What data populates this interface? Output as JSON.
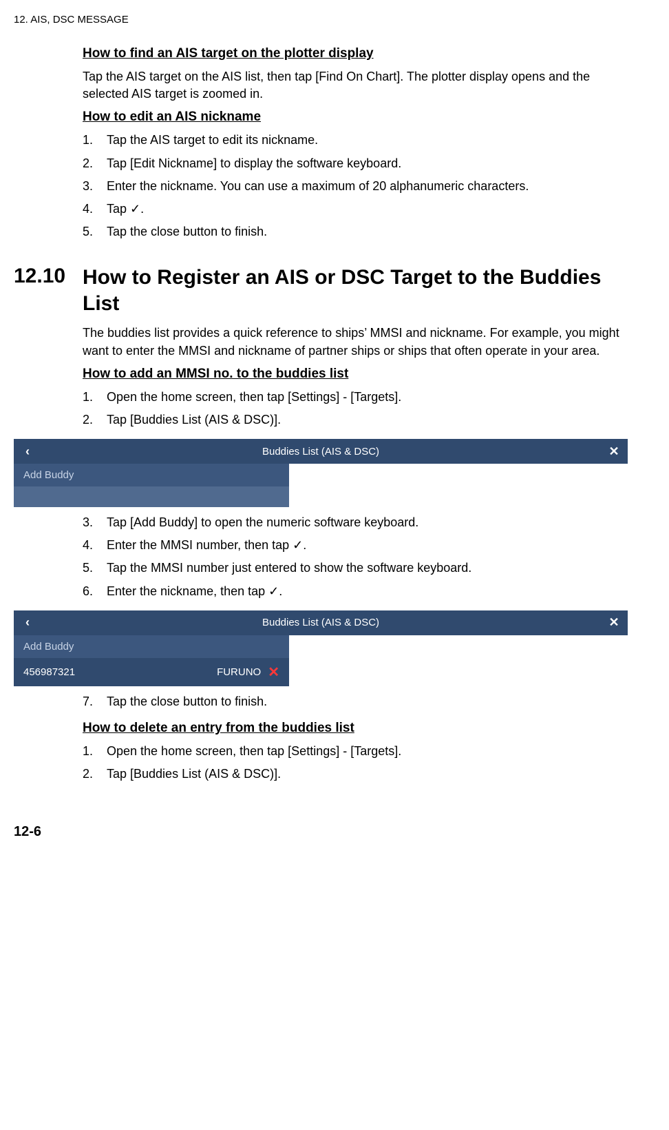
{
  "header": {
    "chapter": "12.  AIS, DSC MESSAGE"
  },
  "s1": {
    "h1": "How to find an AIS target on the plotter display",
    "p1": "Tap the AIS target on the AIS list, then tap [Find On Chart]. The plotter display opens and the selected AIS target is zoomed in.",
    "h2": "How to edit an AIS nickname",
    "items": [
      "Tap the AIS target to edit its nickname.",
      "Tap [Edit Nickname] to display the software keyboard.",
      "Enter the nickname. You can use a maximum of 20 alphanumeric characters.",
      "Tap ✓.",
      "Tap the close button to finish."
    ]
  },
  "s2": {
    "num": "12.10",
    "title": "How to Register an AIS or DSC Target to the Buddies List",
    "p1": "The buddies list provides a quick reference to ships’ MMSI and nickname. For example, you might want to enter the MMSI and nickname of partner ships or ships that often operate in your area.",
    "h1": "How to add an MMSI no. to the buddies list",
    "itemsA": [
      "Open the home screen, then tap [Settings] - [Targets].",
      "Tap [Buddies List (AIS & DSC)]."
    ],
    "itemsB": [
      "Tap [Add Buddy] to open the numeric software keyboard.",
      "Enter the MMSI number, then tap ✓.",
      "Tap the MMSI number just entered to show the software keyboard.",
      "Enter the nickname, then tap ✓."
    ],
    "itemsC": [
      "Tap the close button to finish."
    ],
    "h2": "How to delete an entry from the buddies list",
    "itemsD": [
      "Open the home screen, then tap [Settings] - [Targets].",
      "Tap [Buddies List (AIS & DSC)]."
    ]
  },
  "ui1": {
    "back": "‹",
    "title": "Buddies List (AIS & DSC)",
    "close": "✕",
    "add": "Add Buddy"
  },
  "ui2": {
    "back": "‹",
    "title": "Buddies List (AIS & DSC)",
    "close": "✕",
    "add": "Add Buddy",
    "mmsi": "456987321",
    "nick": "FURUNO",
    "del": "✕"
  },
  "footer": {
    "page": "12-6"
  }
}
